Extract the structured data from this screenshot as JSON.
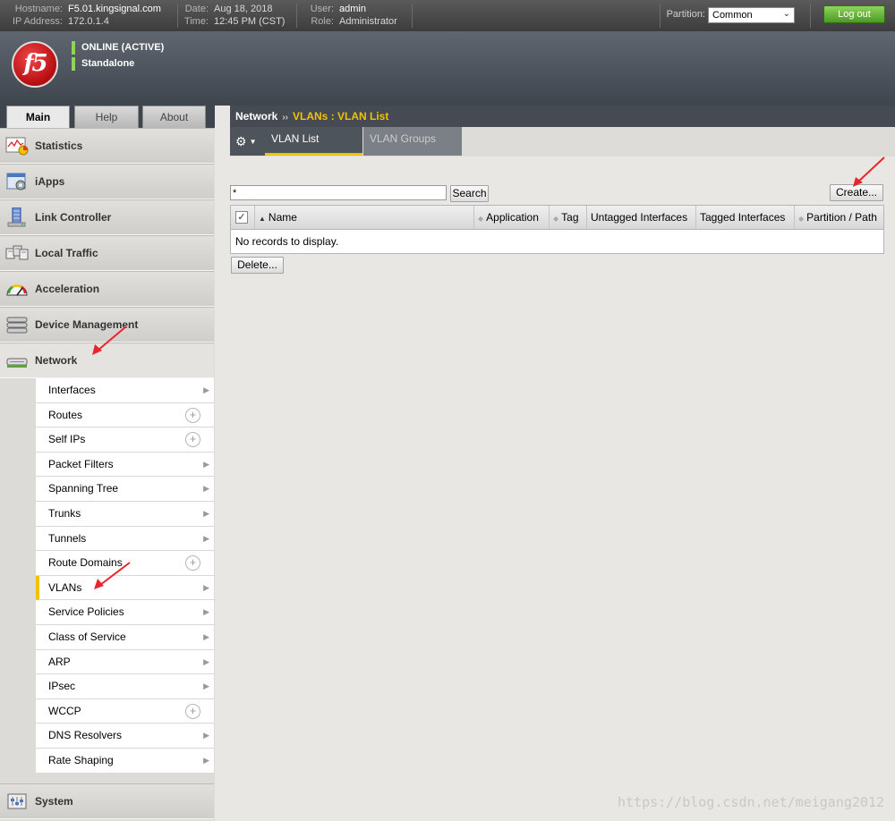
{
  "topbar": {
    "hostname_label": "Hostname:",
    "hostname": "F5.01.kingsignal.com",
    "ip_label": "IP Address:",
    "ip": "172.0.1.4",
    "date_label": "Date:",
    "date": "Aug 18, 2018",
    "time_label": "Time:",
    "time": "12:45 PM (CST)",
    "user_label": "User:",
    "user": "admin",
    "role_label": "Role:",
    "role": "Administrator",
    "partition_label": "Partition:",
    "partition_value": "Common",
    "logout_label": "Log out"
  },
  "header": {
    "logo_text": "f5",
    "status_online": "ONLINE (ACTIVE)",
    "status_mode": "Standalone",
    "status_color": "#8fd35a"
  },
  "main_tabs": [
    {
      "label": "Main",
      "active": true
    },
    {
      "label": "Help",
      "active": false
    },
    {
      "label": "About",
      "active": false
    }
  ],
  "sidebar": {
    "sections": [
      {
        "label": "Statistics",
        "icon": "statistics-icon"
      },
      {
        "label": "iApps",
        "icon": "iapps-icon"
      },
      {
        "label": "Link Controller",
        "icon": "link-controller-icon"
      },
      {
        "label": "Local Traffic",
        "icon": "local-traffic-icon"
      },
      {
        "label": "Acceleration",
        "icon": "acceleration-icon"
      },
      {
        "label": "Device Management",
        "icon": "device-management-icon"
      },
      {
        "label": "Network",
        "icon": "network-icon"
      },
      {
        "label": "System",
        "icon": "system-icon"
      }
    ],
    "network_items": [
      {
        "label": "Interfaces",
        "control": "arrow"
      },
      {
        "label": "Routes",
        "control": "plus"
      },
      {
        "label": "Self IPs",
        "control": "plus"
      },
      {
        "label": "Packet Filters",
        "control": "arrow"
      },
      {
        "label": "Spanning Tree",
        "control": "arrow"
      },
      {
        "label": "Trunks",
        "control": "arrow"
      },
      {
        "label": "Tunnels",
        "control": "arrow"
      },
      {
        "label": "Route Domains",
        "control": "plus"
      },
      {
        "label": "VLANs",
        "control": "arrow",
        "selected": true
      },
      {
        "label": "Service Policies",
        "control": "arrow"
      },
      {
        "label": "Class of Service",
        "control": "arrow"
      },
      {
        "label": "ARP",
        "control": "arrow"
      },
      {
        "label": "IPsec",
        "control": "arrow"
      },
      {
        "label": "WCCP",
        "control": "plus"
      },
      {
        "label": "DNS Resolvers",
        "control": "arrow"
      },
      {
        "label": "Rate Shaping",
        "control": "arrow"
      }
    ]
  },
  "breadcrumb": {
    "section": "Network",
    "separator": "››",
    "current": "VLANs : VLAN List"
  },
  "subtabs": {
    "active": "VLAN List",
    "inactive": "VLAN Groups"
  },
  "toolbar": {
    "search_value": "*",
    "search_label": "Search",
    "create_label": "Create...",
    "delete_label": "Delete..."
  },
  "grid": {
    "columns": [
      "Name",
      "Application",
      "Tag",
      "Untagged Interfaces",
      "Tagged Interfaces",
      "Partition / Path"
    ],
    "empty_message": "No records to display."
  },
  "watermark": "https://blog.csdn.net/meigang2012",
  "colors": {
    "accent_yellow": "#f2c200",
    "annotation_red": "#e8262b",
    "logout_green": "#5aa82f"
  }
}
